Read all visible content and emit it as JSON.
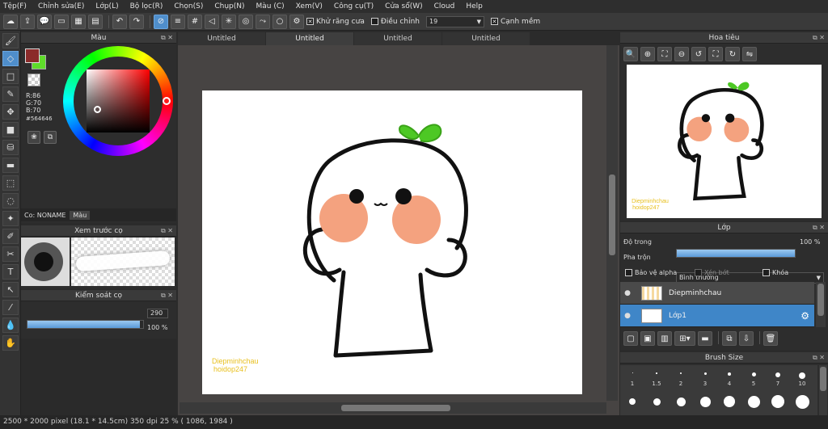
{
  "menu": [
    "Tệp(F)",
    "Chỉnh sửa(E)",
    "Lớp(L)",
    "Bộ lọc(R)",
    "Chọn(S)",
    "Chụp(N)",
    "Màu (C)",
    "Xem(V)",
    "Công cụ(T)",
    "Cửa sổ(W)",
    "Cloud",
    "Help"
  ],
  "toolbar": {
    "antialias_label": "Khử răng cưa",
    "adjust_label": "Điều chỉnh",
    "adjust_value": "19",
    "sharp_edge_label": "Cạnh mềm"
  },
  "color_panel": {
    "title": "Màu",
    "r": "R:86",
    "g": "G:70",
    "b": "B:70",
    "hex": "#564646",
    "tab_label": "Co: NONAME",
    "tab_color": "Màu",
    "current_color": "#564646"
  },
  "brush_preview": {
    "title": "Xem trước cọ"
  },
  "brush_control": {
    "title": "Kiểm soát cọ",
    "size_value": "290",
    "opacity_value": "100 %",
    "size_fraction": 0.97,
    "opacity_fraction": 1.0
  },
  "tabs": [
    "Untitled",
    "Untitled",
    "Untitled",
    "Untitled"
  ],
  "canvas": {
    "signature_line1": "Diepminhchau",
    "signature_line2": "hoidop247"
  },
  "navigator": {
    "title": "Hoa tiêu",
    "signature_line1": "Diepminhchau",
    "signature_line2": "hoidop247"
  },
  "layers": {
    "title": "Lớp",
    "opacity_label": "Độ trong",
    "opacity_value": "100 %",
    "blend_label": "Pha trộn",
    "blend_value": "Bình thường",
    "protect_alpha": "Bảo vệ alpha",
    "clipping": "Xén bớt",
    "lock": "Khóa",
    "items": [
      {
        "name": "Diepminhchau",
        "selected": false
      },
      {
        "name": "Lớp1",
        "selected": true
      }
    ]
  },
  "brush_size": {
    "title": "Brush Size",
    "labels": [
      "1",
      "1.5",
      "2",
      "3",
      "4",
      "5",
      "7",
      "10"
    ]
  },
  "status": "2500 * 2000 pixel  (18.1 * 14.5cm)  350 dpi  25 %  ( 1086, 1984 )"
}
